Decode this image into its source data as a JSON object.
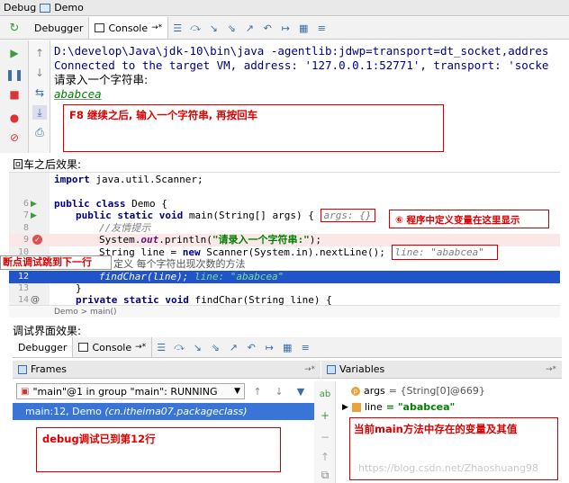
{
  "window": {
    "title_debug": "Debug",
    "title_demo": "Demo"
  },
  "tabs1": {
    "debugger": "Debugger",
    "console": "Console"
  },
  "console": {
    "line1": "D:\\develop\\Java\\jdk-10\\bin\\java -agentlib:jdwp=transport=dt_socket,addres",
    "line2": "Connected to the target VM, address: '127.0.0.1:52771', transport: 'socke",
    "line3": "请录入一个字符串:",
    "line4": "ababcea"
  },
  "note1": "F8 继续之后, 输入一个字符串, 再按回车",
  "section1": "回车之后效果:",
  "code": {
    "l6": "6",
    "l7": "7",
    "l8": "8",
    "l9": "9",
    "l10": "10",
    "l12": "12",
    "l13": "13",
    "l14": "14",
    "import_kw": "import",
    "import_rest": " java.util.Scanner;",
    "public_class": "public class",
    "demo_brace": " Demo {",
    "main_kw": "public static void",
    "main_sig": " main(String[] args) {",
    "args_hint": "args: {}",
    "comment1": "//友情提示",
    "sysout_pre": "System.",
    "sysout_out": "out",
    "sysout_mid": ".println(",
    "sysout_str": "\"请录入一个字符串:\"",
    "sysout_end": ");",
    "line_pre": "String line = ",
    "new_kw": "new",
    "line_rest": " Scanner(System.in).nextLine();",
    "line_hint": "line: \"ababcea\"",
    "comment2_tail": "定义 每个字符出现次数的方法",
    "findchar": "findChar(line);",
    "findchar_hint": "line: \"ababcea\"",
    "close_brace": "}",
    "private_kw": "private static void",
    "findchar_sig": " findChar(String line) {",
    "crumb": "Demo  >  main()"
  },
  "note2": "⑥ 程序中定义变量在这里显示",
  "note3": "断点调试跳到下一行",
  "section2": "调试界面效果:",
  "debugger": {
    "tab_debugger": "Debugger",
    "tab_console": "Console",
    "frames": "Frames",
    "variables": "Variables",
    "thread": "\"main\"@1 in group \"main\": RUNNING",
    "frame_loc": "main:12, Demo",
    "frame_pkg": "(cn.itheima07.packageclass)",
    "var_args_name": "args",
    "var_args_val": "= {String[0]@669}",
    "var_line_name": "line",
    "var_line_val": "= \"ababcea\""
  },
  "note4": "debug调试已到第12行",
  "note5": "当前main方法中存在的变量及其值",
  "watermark": "https://blog.csdn.net/Zhaoshuang98",
  "colors": {
    "accent": "#3875d7",
    "annotation": "#cc0000",
    "keyword": "#000080",
    "string": "#008000"
  }
}
